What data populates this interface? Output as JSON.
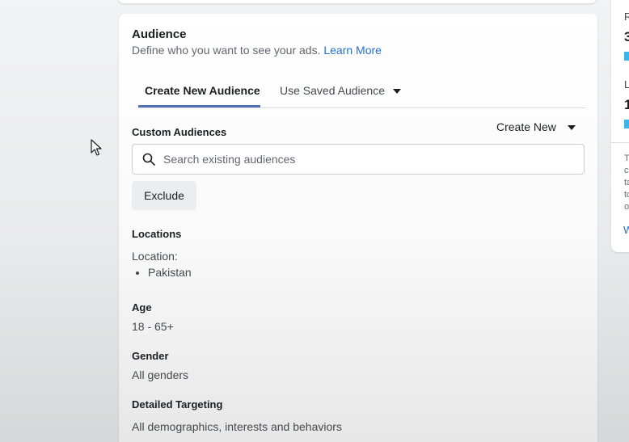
{
  "audience": {
    "title": "Audience",
    "subtitle": "Define who you want to see your ads.",
    "learn_more": "Learn More",
    "tabs": [
      {
        "label": "Create New Audience",
        "active": true
      },
      {
        "label": "Use Saved Audience",
        "active": false
      }
    ],
    "custom_audiences": {
      "label": "Custom Audiences",
      "create_new": "Create New",
      "search_placeholder": "Search existing audiences",
      "exclude_button": "Exclude"
    },
    "locations": {
      "label": "Locations",
      "location_label": "Location:",
      "items": [
        "Pakistan"
      ]
    },
    "age": {
      "label": "Age",
      "value": "18 - 65+"
    },
    "gender": {
      "label": "Gender",
      "value": "All genders"
    },
    "detailed_targeting": {
      "label": "Detailed Targeting",
      "value": "All demographics, interests and behaviors"
    }
  },
  "right_panel": {
    "letters": [
      "R",
      "3",
      "L",
      "1"
    ],
    "small_lines": [
      "T",
      "c",
      "ta",
      "tc",
      "o"
    ],
    "link": "W"
  },
  "colors": {
    "link": "#216fdb",
    "tab_underline": "#4f6fb0",
    "estimate_bar": "#3bb4e8"
  },
  "icons": {
    "search": "search-icon",
    "dropdown": "caret-down-icon",
    "cursor": "mouse-pointer-icon"
  }
}
